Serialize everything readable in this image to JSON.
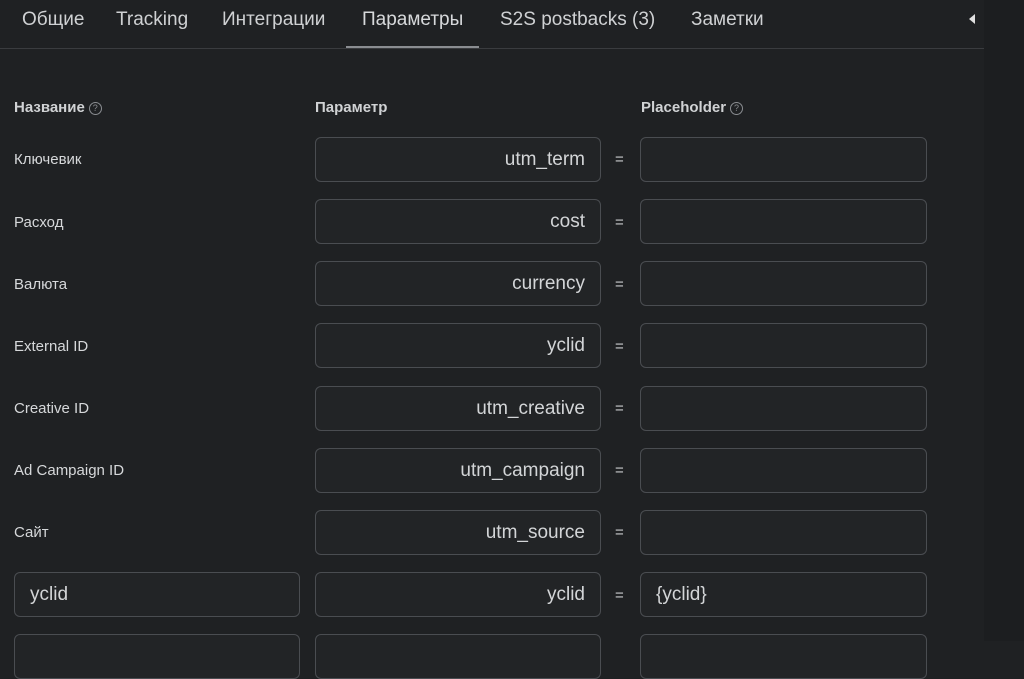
{
  "tabs": [
    {
      "label": "Общие",
      "active": false
    },
    {
      "label": "Tracking",
      "active": false
    },
    {
      "label": "Интеграции",
      "active": false
    },
    {
      "label": "Параметры",
      "active": true
    },
    {
      "label": "S2S postbacks (3)",
      "active": false
    },
    {
      "label": "Заметки",
      "active": false
    }
  ],
  "headers": {
    "name": "Название",
    "parameter": "Параметр",
    "placeholder": "Placeholder",
    "help_glyph": "?"
  },
  "equals": "=",
  "rows": [
    {
      "name": "Ключевик",
      "param": "utm_term",
      "placeholder": ""
    },
    {
      "name": "Расход",
      "param": "cost",
      "placeholder": ""
    },
    {
      "name": "Валюта",
      "param": "currency",
      "placeholder": ""
    },
    {
      "name": "External ID",
      "param": "yclid",
      "placeholder": ""
    },
    {
      "name": "Creative ID",
      "param": "utm_creative",
      "placeholder": ""
    },
    {
      "name": "Ad Campaign ID",
      "param": "utm_campaign",
      "placeholder": ""
    },
    {
      "name": "Сайт",
      "param": "utm_source",
      "placeholder": ""
    }
  ],
  "custom_rows": [
    {
      "name": "yclid",
      "param": "yclid",
      "placeholder": "{yclid}"
    }
  ]
}
